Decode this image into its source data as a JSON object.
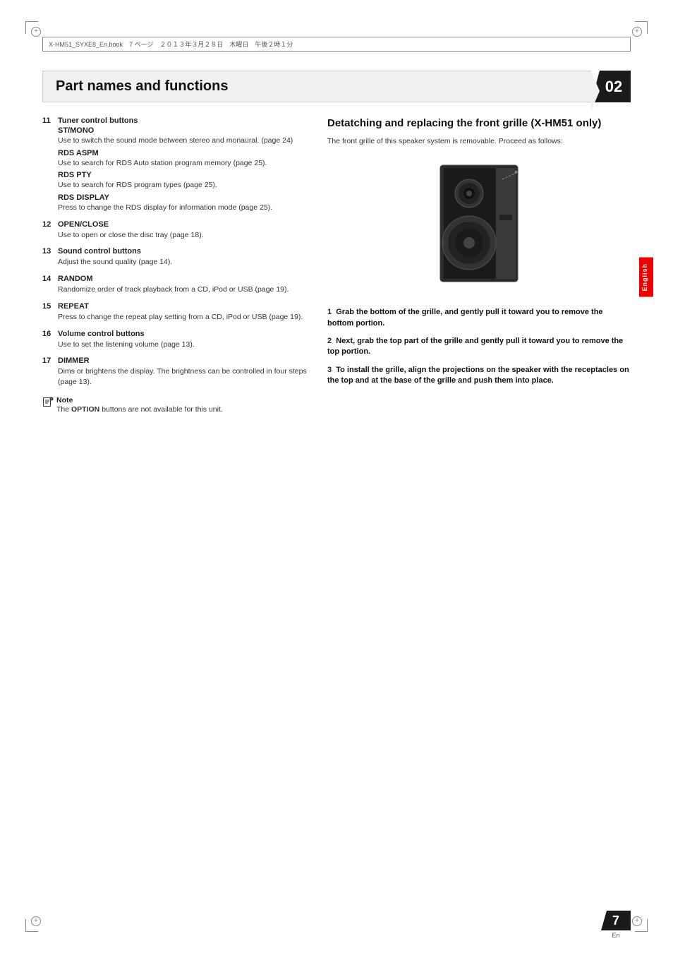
{
  "page": {
    "title": "Part names and functions",
    "chapter": "02",
    "file_info": "X-HM51_SYXE8_En.book　7 ページ　２０１３年３月２８日　木曜日　午後２時１分",
    "page_number": "7",
    "page_label": "En"
  },
  "left_column": {
    "items": [
      {
        "number": "11",
        "title": "Tuner control buttons",
        "subtitles": [
          {
            "label": "ST/MONO",
            "body": "Use to switch the sound mode between stereo and monaural. (page 24)"
          },
          {
            "label": "RDS ASPM",
            "body": "Use to search for RDS Auto station program memory (page 25)."
          },
          {
            "label": "RDS PTY",
            "body": "Use to search for RDS program types (page 25)."
          },
          {
            "label": "RDS DISPLAY",
            "body": "Press to change the RDS display for information mode (page 25)."
          }
        ]
      },
      {
        "number": "12",
        "title": "OPEN/CLOSE",
        "body": "Use to open or close the disc tray (page 18)."
      },
      {
        "number": "13",
        "title": "Sound control buttons",
        "body": "Adjust the sound quality (page 14)."
      },
      {
        "number": "14",
        "title": "RANDOM",
        "body": "Randomize order of track playback from a CD, iPod or USB (page 19)."
      },
      {
        "number": "15",
        "title": "REPEAT",
        "body": "Press to change the repeat play setting from a CD, iPod or USB (page 19)."
      },
      {
        "number": "16",
        "title": "Volume control buttons",
        "body": "Use to set the listening volume (page 13)."
      },
      {
        "number": "17",
        "title": "DIMMER",
        "body": "Dims or brightens the display. The brightness can be controlled in four steps (page 13)."
      }
    ],
    "note": {
      "label": "Note",
      "text": "The OPTION buttons are not available for this unit."
    }
  },
  "right_column": {
    "section_title": "Detatching and replacing the front grille (X-HM51 only)",
    "section_intro": "The front grille of this speaker system is removable. Proceed as follows:",
    "steps": [
      {
        "number": "1",
        "text": "Grab the bottom of the grille, and gently pull it toward you to remove the bottom portion."
      },
      {
        "number": "2",
        "text": "Next, grab the top part of the grille and gently pull it toward you to remove the top portion."
      },
      {
        "number": "3",
        "text": "To install the grille, align the projections on the speaker with the receptacles on the top and at the base of the grille and push them into place."
      }
    ]
  },
  "sidebar": {
    "english_label": "English"
  }
}
